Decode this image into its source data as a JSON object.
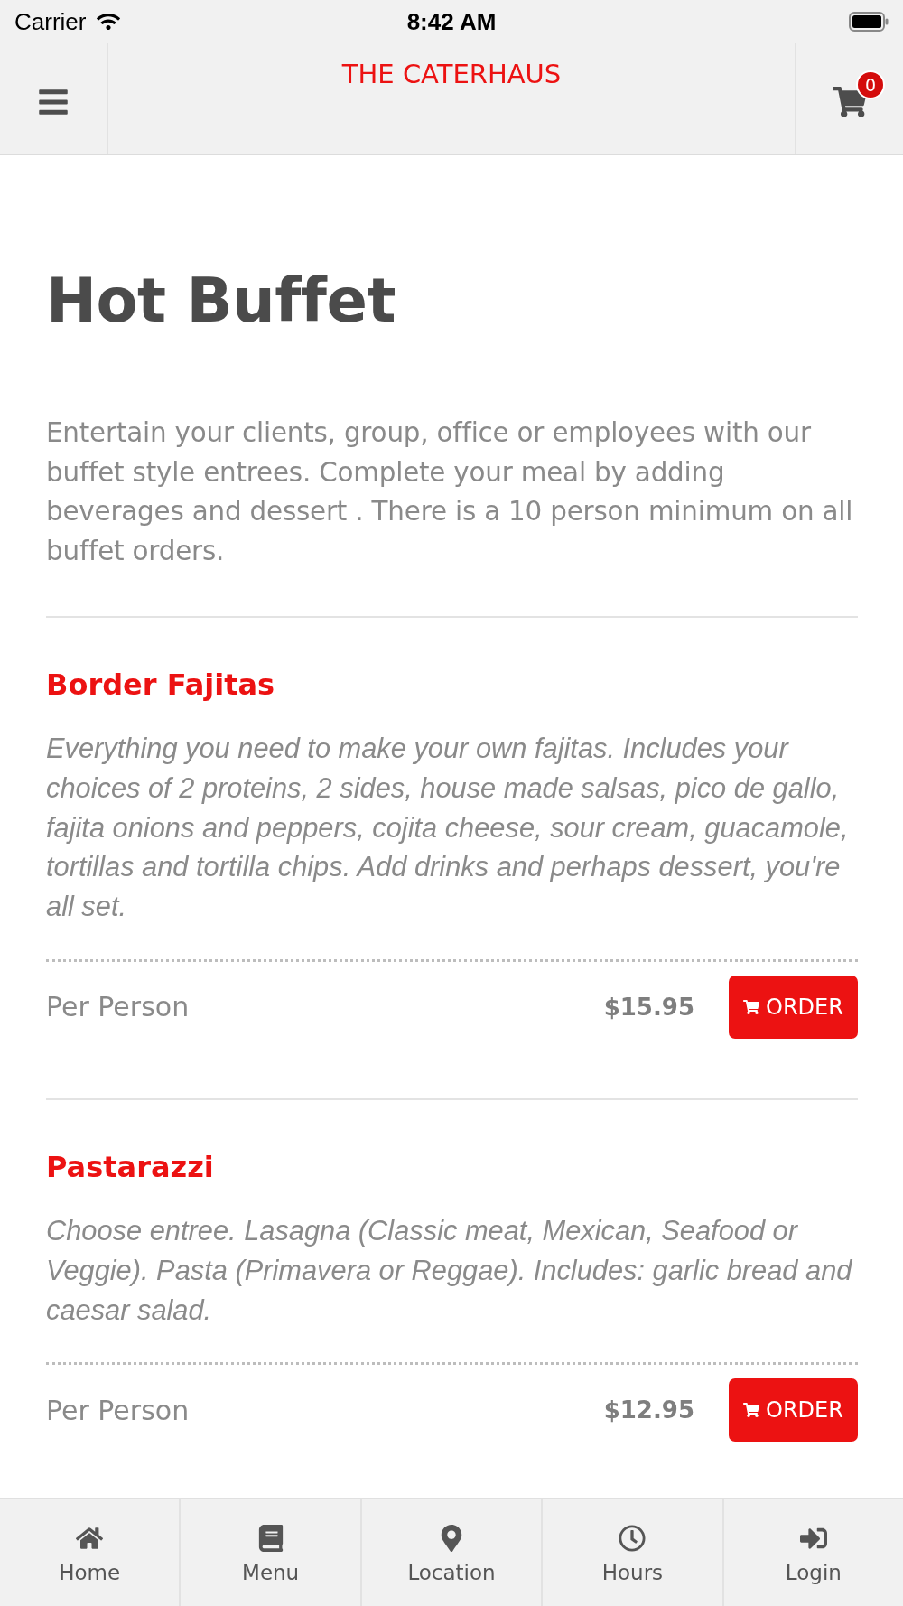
{
  "status_bar": {
    "carrier": "Carrier",
    "time": "8:42 AM"
  },
  "header": {
    "title": "THE CATERHAUS",
    "cart_count": "0"
  },
  "page": {
    "title": "Hot Buffet",
    "intro": "Entertain your clients, group, office or employees with our buffet style entrees. Complete your meal by adding beverages and dessert . There is a 10 person minimum on all buffet orders."
  },
  "items": [
    {
      "name": "Border Fajitas",
      "description": "Everything you need to make your own fajitas. Includes your choices of 2 proteins, 2 sides, house made salsas, pico de gallo, fajita onions and peppers, cojita cheese, sour cream, guacamole, tortillas and tortilla chips. Add drinks and perhaps dessert, you're all set.",
      "unit": "Per Person",
      "price": "$15.95",
      "button": "ORDER"
    },
    {
      "name": "Pastarazzi",
      "description": "Choose entree. Lasagna (Classic meat, Mexican, Seafood or Veggie). Pasta (Primavera or Reggae). Includes: garlic bread and caesar salad.",
      "unit": "Per Person",
      "price": "$12.95",
      "button": "ORDER"
    }
  ],
  "tab_bar": [
    {
      "label": "Home"
    },
    {
      "label": "Menu"
    },
    {
      "label": "Location"
    },
    {
      "label": "Hours"
    },
    {
      "label": "Login"
    }
  ]
}
